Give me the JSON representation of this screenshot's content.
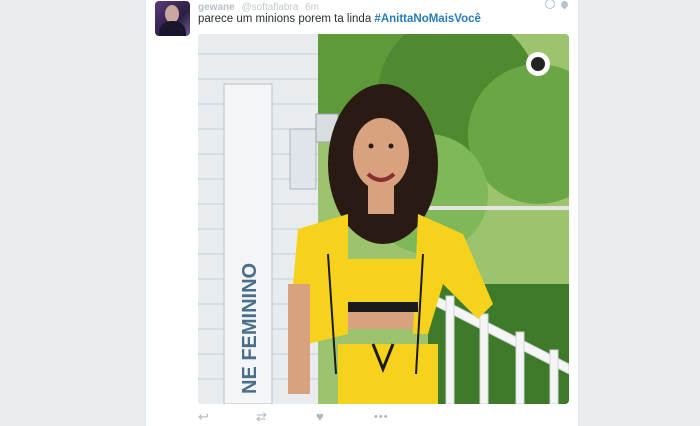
{
  "tweet": {
    "author_name": "gewane",
    "author_handle": "@softaflabra",
    "time": "6m",
    "text": "parece um minions porem ta linda ",
    "hashtag": "#AnittaNoMaisVocê",
    "photo_sign_text": "NE FEMININO"
  },
  "icons": {
    "globe": "globe-icon",
    "location": "location-pin-icon",
    "reply": "reply-icon",
    "retweet": "retweet-icon",
    "like": "heart-icon",
    "more": "more-dots-icon"
  },
  "colors": {
    "link": "#2b7bb9",
    "text": "#292f33",
    "icon": "#aab8c2",
    "outfit": "#f6d21c"
  }
}
